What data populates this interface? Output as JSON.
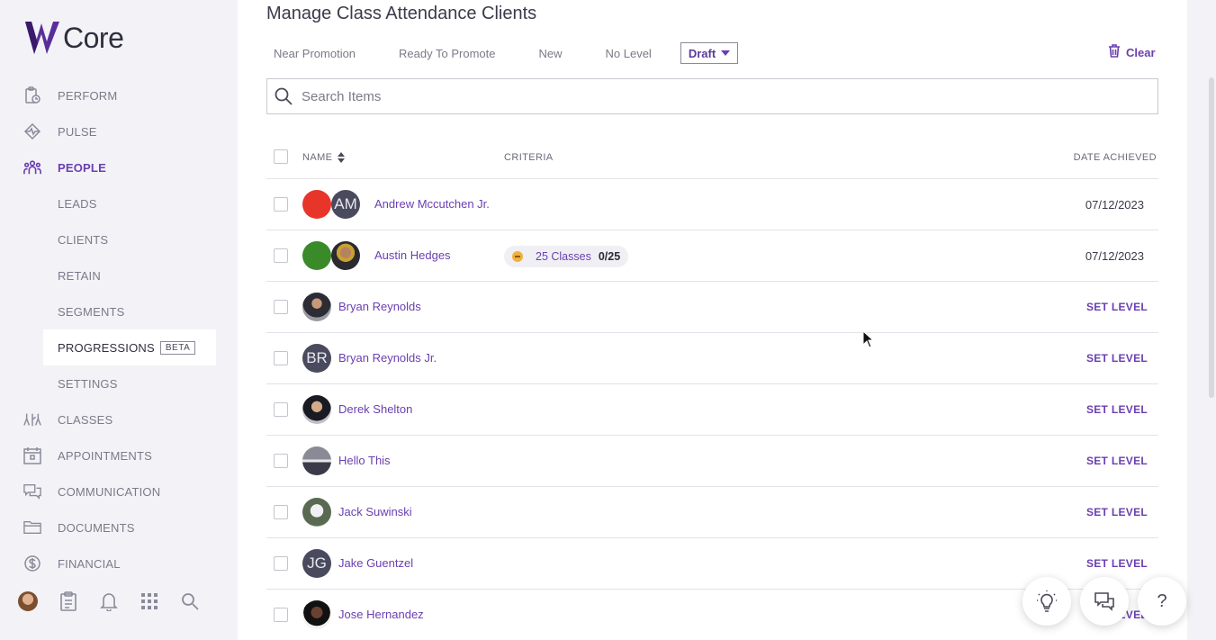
{
  "app": {
    "logo_text": "Core"
  },
  "sidebar": {
    "items": [
      {
        "label": "PERFORM",
        "icon": "clipboard-clock-icon"
      },
      {
        "label": "PULSE",
        "icon": "pulse-diamond-icon"
      },
      {
        "label": "PEOPLE",
        "icon": "people-group-icon"
      },
      {
        "label": "LEADS"
      },
      {
        "label": "CLIENTS"
      },
      {
        "label": "RETAIN"
      },
      {
        "label": "SEGMENTS"
      },
      {
        "label": "PROGRESSIONS",
        "badge": "BETA"
      },
      {
        "label": "SETTINGS"
      },
      {
        "label": "CLASSES",
        "icon": "classes-figures-icon"
      },
      {
        "label": "APPOINTMENTS",
        "icon": "calendar-icon"
      },
      {
        "label": "COMMUNICATION",
        "icon": "chat-bubbles-icon"
      },
      {
        "label": "DOCUMENTS",
        "icon": "folder-icon"
      },
      {
        "label": "FINANCIAL",
        "icon": "dollar-circle-icon"
      }
    ],
    "footer_icons": [
      "user-avatar",
      "clipboard-icon",
      "bell-icon",
      "apps-grid-icon",
      "search-icon"
    ]
  },
  "main": {
    "title": "Manage Class Attendance Clients",
    "filters": [
      "Near Promotion",
      "Ready To Promote",
      "New",
      "No Level"
    ],
    "status_select": "Draft",
    "clear_label": "Clear",
    "search_placeholder": "Search Items"
  },
  "table": {
    "headers": {
      "name": "NAME",
      "criteria": "CRITERIA",
      "date": "DATE ACHIEVED"
    },
    "set_level_label": "SET LEVEL",
    "rows": [
      {
        "name": "Andrew Mccutchen Jr.",
        "status_color": "#e8352a",
        "initials": "AM",
        "date": "07/12/2023"
      },
      {
        "name": "Austin Hedges",
        "status_color": "#3a8a2a",
        "criteria_label": "25 Classes",
        "criteria_count": "0/25",
        "date": "07/12/2023"
      },
      {
        "name": "Bryan Reynolds",
        "action": "SET LEVEL"
      },
      {
        "name": "Bryan Reynolds Jr.",
        "initials": "BR",
        "action": "SET LEVEL"
      },
      {
        "name": "Derek Shelton",
        "action": "SET LEVEL"
      },
      {
        "name": "Hello This",
        "action": "SET LEVEL"
      },
      {
        "name": "Jack Suwinski",
        "action": "SET LEVEL"
      },
      {
        "name": "Jake Guentzel",
        "initials": "JG",
        "action": "SET LEVEL"
      },
      {
        "name": "Jose Hernandez",
        "action": "SET LEVEL"
      }
    ]
  },
  "fabs": [
    "lightbulb-icon",
    "chat-icon",
    "help-icon"
  ],
  "help_glyph": "?",
  "colors": {
    "accent": "#6a3fb0",
    "sidebar_bg": "#f3f3f7"
  }
}
